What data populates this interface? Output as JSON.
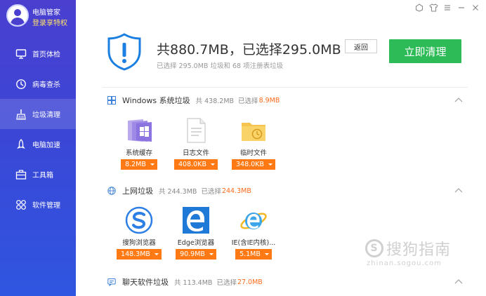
{
  "profile": {
    "name": "电脑管家",
    "login": "登录享特权"
  },
  "nav": [
    {
      "label": "首页体检",
      "icon": "monitor-icon",
      "active": false
    },
    {
      "label": "病毒查杀",
      "icon": "virus-scan-icon",
      "active": false
    },
    {
      "label": "垃圾清理",
      "icon": "broom-icon",
      "active": true
    },
    {
      "label": "电脑加速",
      "icon": "rocket-icon",
      "active": false
    },
    {
      "label": "工具箱",
      "icon": "toolbox-icon",
      "active": false
    },
    {
      "label": "软件管理",
      "icon": "software-icon",
      "active": false
    }
  ],
  "titlebar": [
    "skin-icon",
    "shirt-icon",
    "menu-icon",
    "minimize-icon",
    "close-icon"
  ],
  "header": {
    "headline": "共880.7MB，已选择295.0MB",
    "back_label": "返回",
    "subline": "已选择 295.0MB 垃圾和 68 项注册表垃圾",
    "clean_label": "立即清理"
  },
  "sections": [
    {
      "title": "Windows 系统垃圾",
      "total": "共 438.2MB",
      "selected_label": "已选择",
      "selected_value": "8.9MB",
      "items": [
        {
          "label": "系统缓存",
          "size": "8.2MB",
          "icon": "windows-cache-icon"
        },
        {
          "label": "日志文件",
          "size": "408.0KB",
          "icon": "log-file-icon"
        },
        {
          "label": "临时文件",
          "size": "348.0KB",
          "icon": "temp-folder-icon"
        }
      ]
    },
    {
      "title": "上网垃圾",
      "total": "共 244.3MB",
      "selected_label": "已选择",
      "selected_value": "244.3MB",
      "items": [
        {
          "label": "搜狗浏览器",
          "size": "148.3MB",
          "icon": "sogou-browser-icon"
        },
        {
          "label": "Edge浏览器",
          "size": "90.9MB",
          "icon": "edge-browser-icon"
        },
        {
          "label": "IE(含IE内核)...",
          "size": "5.1MB",
          "icon": "ie-browser-icon"
        }
      ]
    },
    {
      "title": "聊天软件垃圾",
      "total": "共 113.4MB",
      "selected_label": "已选择",
      "selected_value": "27.0MB",
      "items": []
    }
  ],
  "watermark": {
    "text": "搜狗指南",
    "url": "zhinan.sogou.com"
  },
  "colors": {
    "accent_green": "#2dbb57",
    "accent_orange": "#ff7a15",
    "sidebar": "#3b46d6",
    "shield_blue": "#1a7fe0"
  }
}
